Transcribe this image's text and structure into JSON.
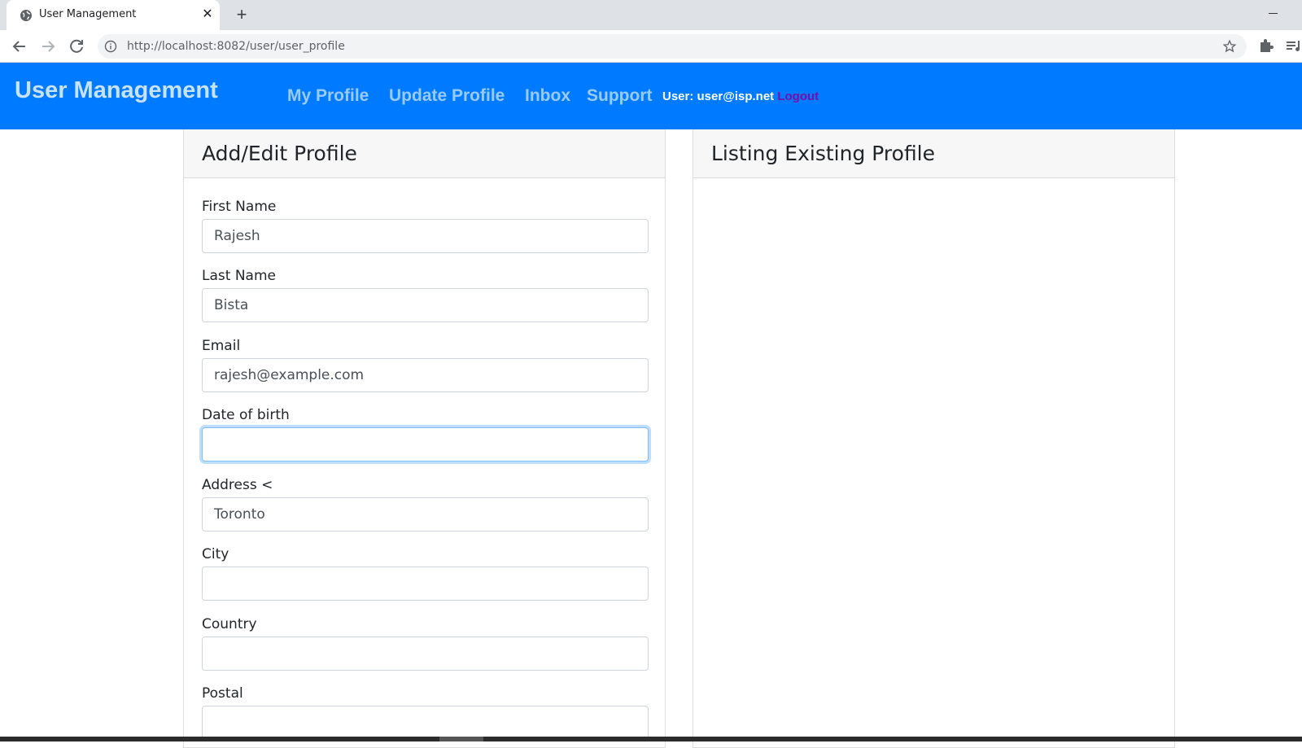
{
  "browser": {
    "tab_title": "User Management",
    "url_host": "http://localhost",
    "url_rest": ":8082/user/user_profile",
    "icons": [
      "globe-icon",
      "close-icon",
      "plus-icon",
      "back-icon",
      "forward-icon",
      "reload-icon",
      "info-icon",
      "star-icon",
      "puzzle-icon",
      "media-icon"
    ]
  },
  "navbar": {
    "brand": "User Management",
    "links": [
      "My Profile",
      "Update Profile",
      "Inbox",
      "Support"
    ],
    "user_label": "User: user@isp.net",
    "logout": "Logout",
    "colors": {
      "background": "#007bff",
      "logout": "#7a0fa8"
    }
  },
  "form_card": {
    "title": "Add/Edit Profile",
    "fields": [
      {
        "label": "First Name",
        "value": "Rajesh"
      },
      {
        "label": "Last Name",
        "value": "Bista"
      },
      {
        "label": "Email",
        "value": "rajesh@example.com"
      },
      {
        "label": "Date of birth",
        "value": ""
      },
      {
        "label": "Address <",
        "value": "Toronto"
      },
      {
        "label": "City",
        "value": ""
      },
      {
        "label": "Country",
        "value": ""
      },
      {
        "label": "Postal",
        "value": ""
      }
    ]
  },
  "listing_card": {
    "title": "Listing Existing Profile"
  }
}
